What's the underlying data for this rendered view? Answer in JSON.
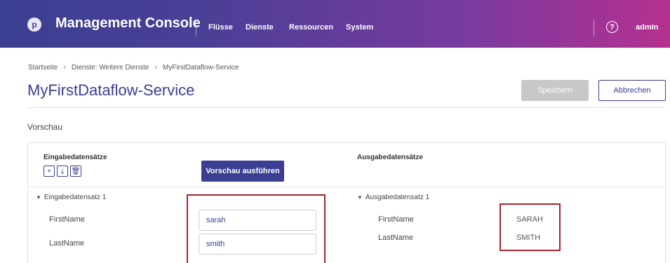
{
  "header": {
    "logo_glyph": "p",
    "title": "Management Console",
    "nav": [
      "Flüsse",
      "Dienste",
      "Ressourcen",
      "System"
    ],
    "help_glyph": "?",
    "user": "admin",
    "gradient_colors": [
      "#3b3f92",
      "#b5308f"
    ]
  },
  "breadcrumb": [
    "Startseite",
    "Dienste: Weitere Dienste",
    "MyFirstDataflow-Service"
  ],
  "page": {
    "title": "MyFirstDataflow-Service",
    "save_label": "Speichern",
    "cancel_label": "Abbrechen"
  },
  "preview": {
    "section_title": "Vorschau",
    "input_header": "Eingabedatensätze",
    "output_header": "Ausgabedatensätze",
    "run_label": "Vorschau ausführen",
    "toolbar_glyphs": [
      "+",
      "⤓",
      "🗑"
    ],
    "input_record": {
      "title": "Eingabedatensatz 1",
      "fields": [
        {
          "label": "FirstName",
          "value": "sarah"
        },
        {
          "label": "LastName",
          "value": "smith"
        }
      ]
    },
    "output_record": {
      "title": "Ausgabedatensatz 1",
      "fields": [
        {
          "label": "FirstName",
          "value": "SARAH"
        },
        {
          "label": "LastName",
          "value": "SMITH"
        }
      ]
    }
  },
  "colors": {
    "primary": "#3b3f92",
    "highlight": "#a3252d",
    "disabled": "#c8c8c8"
  }
}
